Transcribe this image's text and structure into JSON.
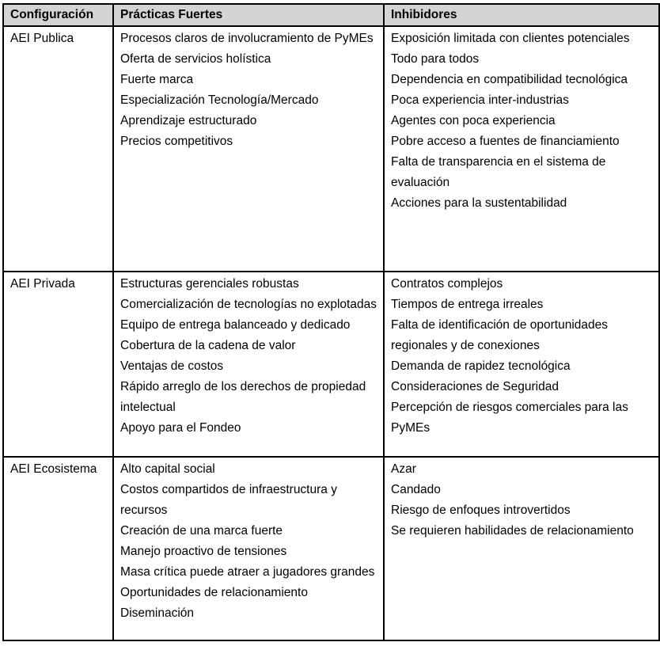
{
  "table": {
    "headers": {
      "configuracion": "Configuración",
      "practicas": "Prácticas Fuertes",
      "inhibidores": "Inhibidores"
    },
    "rows": [
      {
        "config": "AEI Publica",
        "practicas": [
          "Procesos claros de involucramiento de PyMEs",
          "Oferta de servicios holística",
          "Fuerte marca",
          "Especialización Tecnología/Mercado",
          "Aprendizaje estructurado",
          "Precios competitivos"
        ],
        "inhibidores": [
          "Exposición limitada con clientes potenciales",
          "Todo para todos",
          "Dependencia en compatibilidad tecnológica",
          "Poca experiencia inter-industrias",
          "Agentes con poca experiencia",
          "Pobre acceso a fuentes de financiamiento",
          "Falta de transparencia en el sistema de evaluación",
          "Acciones para la sustentabilidad"
        ]
      },
      {
        "config": "AEI Privada",
        "practicas": [
          "Estructuras gerenciales robustas",
          "Comercialización de tecnologías no explotadas",
          "Equipo de entrega balanceado y dedicado",
          "Cobertura de la cadena de valor",
          "Ventajas de costos",
          "Rápido arreglo de los derechos de propiedad intelectual",
          "Apoyo para el Fondeo"
        ],
        "inhibidores": [
          "Contratos complejos",
          "Tiempos de entrega irreales",
          "Falta de identificación de oportunidades regionales y de conexiones",
          "Demanda de rapidez tecnológica",
          "Consideraciones de Seguridad",
          "Percepción de riesgos comerciales para las PyMEs"
        ]
      },
      {
        "config": "AEI Ecosistema",
        "practicas": [
          "Alto capital social",
          "Costos compartidos de infraestructura y recursos",
          "Creación de una marca fuerte",
          "Manejo proactivo de tensiones",
          "Masa crítica puede atraer a jugadores grandes",
          "Oportunidades de relacionamiento",
          "Diseminación"
        ],
        "inhibidores": [
          "Azar",
          "Candado",
          "Riesgo de enfoques introvertidos",
          "Se requieren habilidades de relacionamiento"
        ]
      }
    ]
  }
}
